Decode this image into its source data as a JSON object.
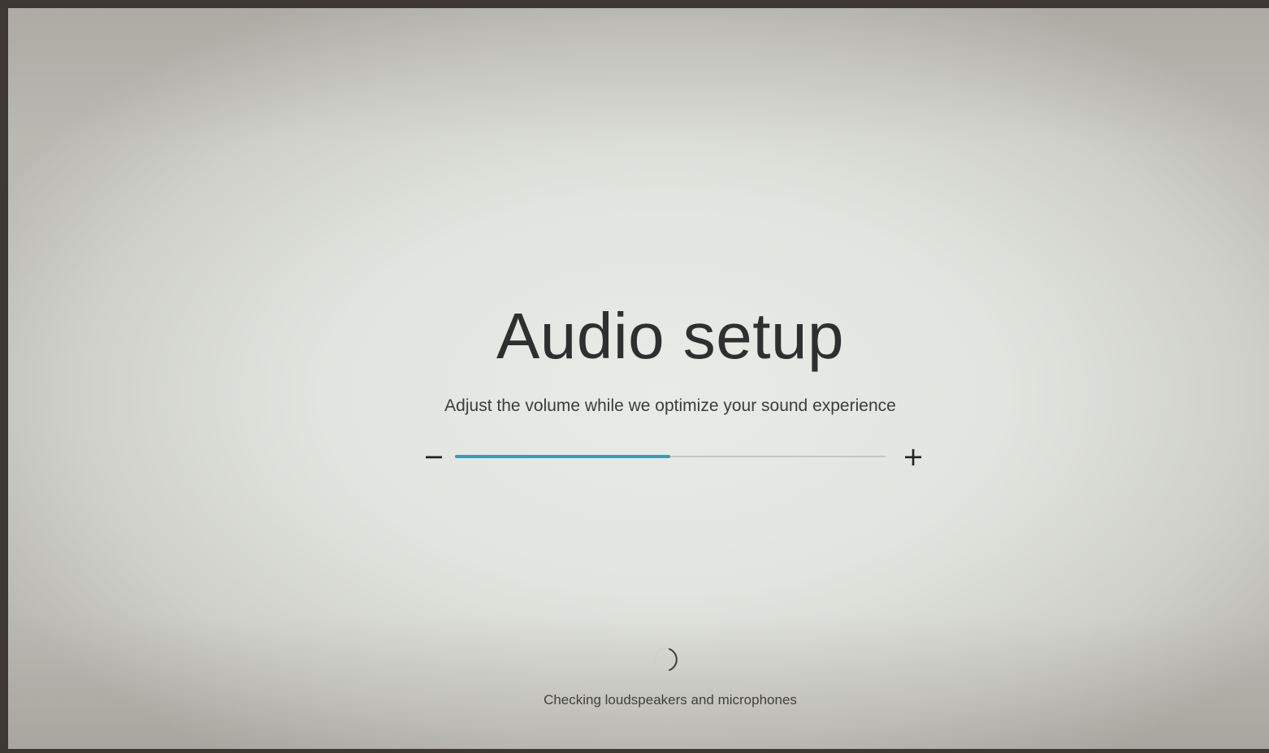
{
  "screen": {
    "title": "Audio setup",
    "subtitle": "Adjust the volume while we optimize your sound experience",
    "status": "Checking loudspeakers and microphones"
  },
  "volume": {
    "minus_label": "−",
    "plus_label": "+",
    "level": 0.5,
    "accent_color": "#2aa0c8"
  },
  "icons": {
    "spinner": "loading-spinner-icon"
  }
}
